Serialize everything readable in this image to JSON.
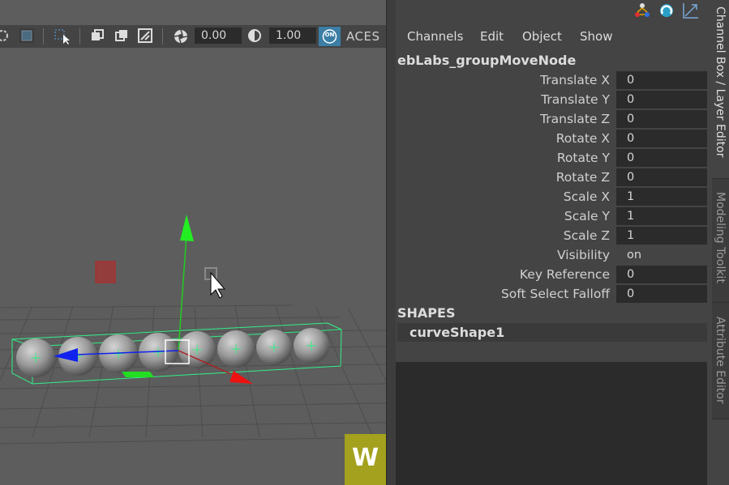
{
  "viewport_toolbar": {
    "field_exposure": "0.00",
    "field_gamma": "1.00",
    "colorspace_toggle": "ON",
    "colorspace_label": "ACES",
    "icons": [
      "lasso-icon",
      "shaded-icon",
      "select-camera-icon",
      "isolate-icon",
      "xray-icon",
      "wireframe-icon",
      "exposure-icon",
      "gamma-icon"
    ]
  },
  "watermark": {
    "letter": "W",
    "color": "#a3a11d"
  },
  "channel_box": {
    "top_icons": [
      "channel-box-icon",
      "attribute-icon",
      "tool-settings-icon"
    ],
    "menu": [
      "Channels",
      "Edit",
      "Object",
      "Show"
    ],
    "node_name": "ebLabs_groupMoveNode",
    "attributes": [
      {
        "label": "Translate X",
        "value": "0"
      },
      {
        "label": "Translate Y",
        "value": "0"
      },
      {
        "label": "Translate Z",
        "value": "0"
      },
      {
        "label": "Rotate X",
        "value": "0"
      },
      {
        "label": "Rotate Y",
        "value": "0"
      },
      {
        "label": "Rotate Z",
        "value": "0"
      },
      {
        "label": "Scale X",
        "value": "1"
      },
      {
        "label": "Scale Y",
        "value": "1"
      },
      {
        "label": "Scale Z",
        "value": "1"
      },
      {
        "label": "Visibility",
        "value": "on"
      },
      {
        "label": "Key Reference",
        "value": "0"
      },
      {
        "label": "Soft Select Falloff",
        "value": "0"
      }
    ],
    "shapes_header": "SHAPES",
    "shape_name": "curveShape1"
  },
  "side_tabs": [
    {
      "label": "Channel Box / Layer Editor",
      "active": true
    },
    {
      "label": "Modeling Toolkit",
      "active": false
    },
    {
      "label": "Attribute Editor",
      "active": false
    }
  ],
  "colors": {
    "viewport_bg": "#5d5d5d",
    "panel_bg": "#444444",
    "field_bg": "#2b2b2b",
    "manip_y": "#22cc22",
    "manip_x": "#dd1111",
    "manip_z": "#1111ee",
    "bbox": "#33ee88"
  }
}
